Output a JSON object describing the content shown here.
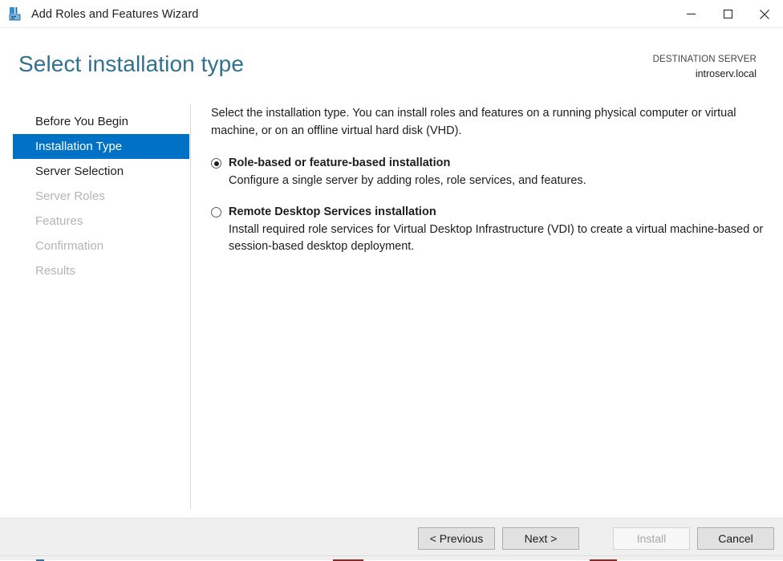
{
  "window": {
    "title": "Add Roles and Features Wizard",
    "icon": "server-wizard-icon",
    "controls": {
      "minimize": "minimize-icon",
      "maximize": "maximize-icon",
      "close": "close-icon"
    }
  },
  "header": {
    "page_title": "Select installation type",
    "destination_label": "DESTINATION SERVER",
    "destination_value": "introserv.local"
  },
  "sidebar": {
    "items": [
      {
        "label": "Before You Begin",
        "state": "enabled"
      },
      {
        "label": "Installation Type",
        "state": "selected"
      },
      {
        "label": "Server Selection",
        "state": "enabled"
      },
      {
        "label": "Server Roles",
        "state": "disabled"
      },
      {
        "label": "Features",
        "state": "disabled"
      },
      {
        "label": "Confirmation",
        "state": "disabled"
      },
      {
        "label": "Results",
        "state": "disabled"
      }
    ]
  },
  "content": {
    "intro": "Select the installation type. You can install roles and features on a running physical computer or virtual machine, or on an offline virtual hard disk (VHD).",
    "options": [
      {
        "label": "Role-based or feature-based installation",
        "description": "Configure a single server by adding roles, role services, and features.",
        "selected": true
      },
      {
        "label": "Remote Desktop Services installation",
        "description": "Install required role services for Virtual Desktop Infrastructure (VDI) to create a virtual machine-based or session-based desktop deployment.",
        "selected": false
      }
    ]
  },
  "footer": {
    "previous_label": "< Previous",
    "next_label": "Next >",
    "install_label": "Install",
    "cancel_label": "Cancel",
    "install_enabled": false
  },
  "colors": {
    "accent_blue": "#0072c6",
    "title_blue": "#31708f",
    "footer_bg": "#efefef",
    "disabled_text": "#b4b4b4"
  }
}
